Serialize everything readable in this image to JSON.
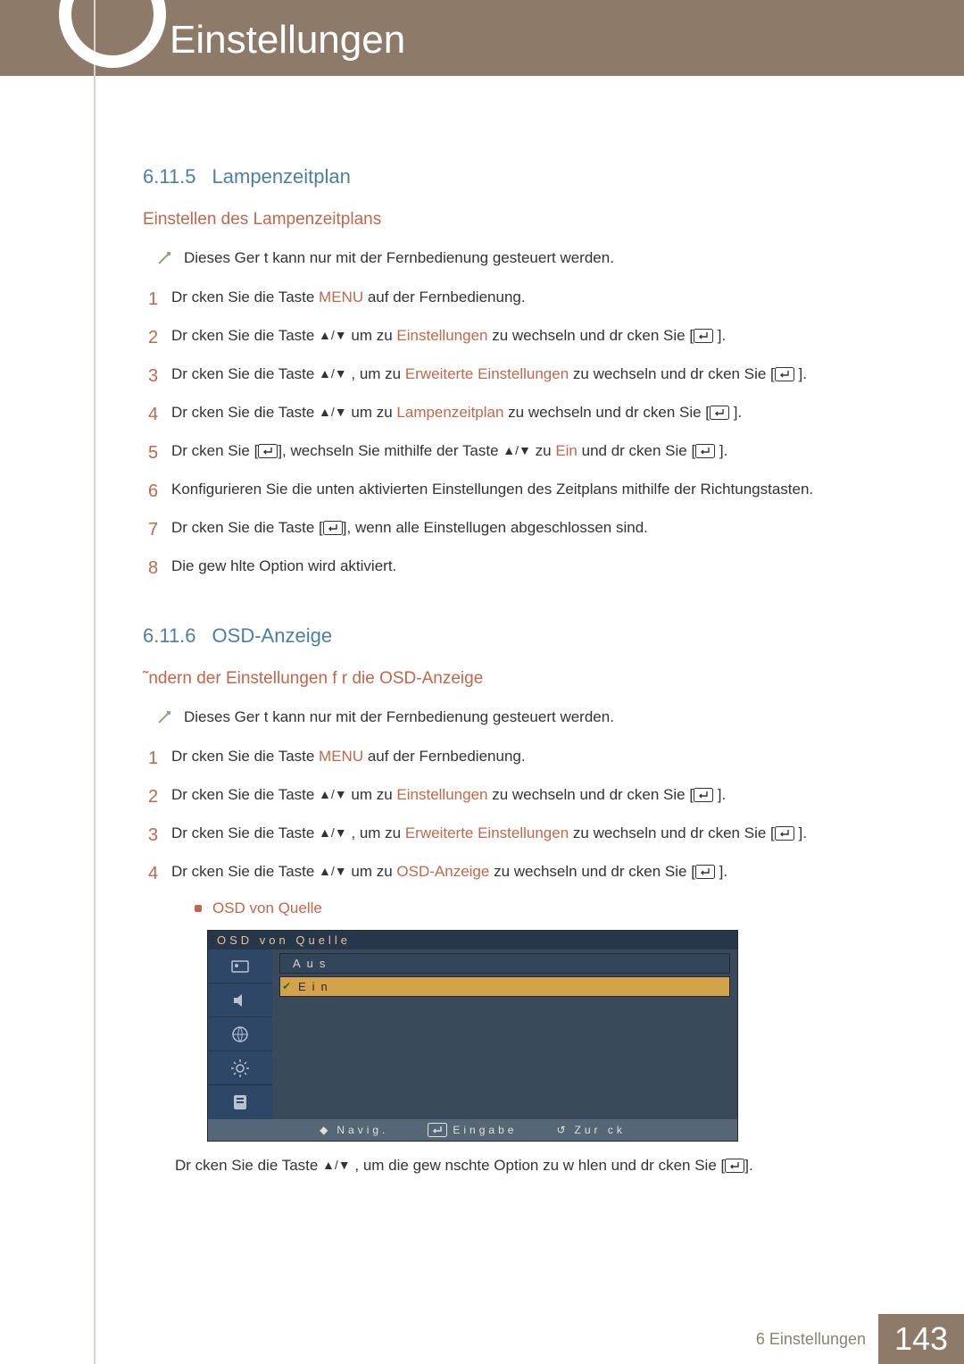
{
  "header": {
    "chapter_title": "Einstellungen"
  },
  "sec1": {
    "num": "6.11.5",
    "title": "Lampenzeitplan",
    "sub": "Einstellen des Lampenzeitplans",
    "note": "Dieses Ger t kann nur mit der Fernbedienung gesteuert werden.",
    "steps": {
      "s1_a": "Dr cken Sie die Taste ",
      "s1_menu": "MENU",
      "s1_b": " auf der Fernbedienung.",
      "s2_a": "Dr cken Sie die Taste ",
      "s2_mid": " um zu ",
      "s2_kw": "Einstellungen",
      "s2_b": " zu wechseln und dr cken Sie [",
      "s3_a": "Dr cken Sie die Taste ",
      "s3_mid": " , um zu ",
      "s3_kw": "Erweiterte Einstellungen",
      "s3_b": " zu wechseln und dr cken Sie ",
      "s4_a": "Dr cken Sie die Taste ",
      "s4_mid": " um zu ",
      "s4_kw": "Lampenzeitplan",
      "s4_b": " zu wechseln und dr cken Sie [",
      "s5_a": "Dr cken Sie [",
      "s5_b": "], wechseln Sie mithilfe der Taste ",
      "s5_mid": " zu ",
      "s5_kw": "Ein",
      "s5_c": " und dr cken Sie [",
      "s6": "Konfigurieren Sie die unten aktivierten Einstellungen des Zeitplans mithilfe der Richtungstasten.",
      "s7_a": "Dr cken Sie die Taste [",
      "s7_b": "], wenn alle Einstellugen abgeschlossen sind.",
      "s8": "Die gew hlte Option wird aktiviert."
    }
  },
  "sec2": {
    "num": "6.11.6",
    "title": "OSD-Anzeige",
    "sub": "˜ndern der Einstellungen f r die OSD-Anzeige",
    "note": "Dieses Ger t kann nur mit der Fernbedienung gesteuert werden.",
    "steps": {
      "s1_a": "Dr cken Sie die Taste ",
      "s1_menu": "MENU",
      "s1_b": " auf der Fernbedienung.",
      "s2_a": "Dr cken Sie die Taste ",
      "s2_mid": " um zu ",
      "s2_kw": "Einstellungen",
      "s2_b": " zu wechseln und dr cken Sie [",
      "s3_a": "Dr cken Sie die Taste ",
      "s3_mid": " , um zu ",
      "s3_kw": "Erweiterte Einstellungen",
      "s3_b": " zu wechseln und dr cken Sie ",
      "s4_a": "Dr cken Sie die Taste ",
      "s4_mid": " um zu ",
      "s4_kw": "OSD-Anzeige",
      "s4_b": " zu wechseln und dr cken Sie [",
      "after_a": "Dr cken Sie die Taste ",
      "after_mid": " , um die gew nschte Option zu w hlen und dr cken Sie ["
    },
    "bullet": "OSD von Quelle"
  },
  "osd": {
    "title": "OSD von Quelle",
    "opt_off": "Aus",
    "opt_on": "Ein",
    "foot_nav": "Navig.",
    "foot_enter": "Eingabe",
    "foot_back": "Zur  ck"
  },
  "footer": {
    "label": "6 Einstellungen",
    "page": "143"
  }
}
